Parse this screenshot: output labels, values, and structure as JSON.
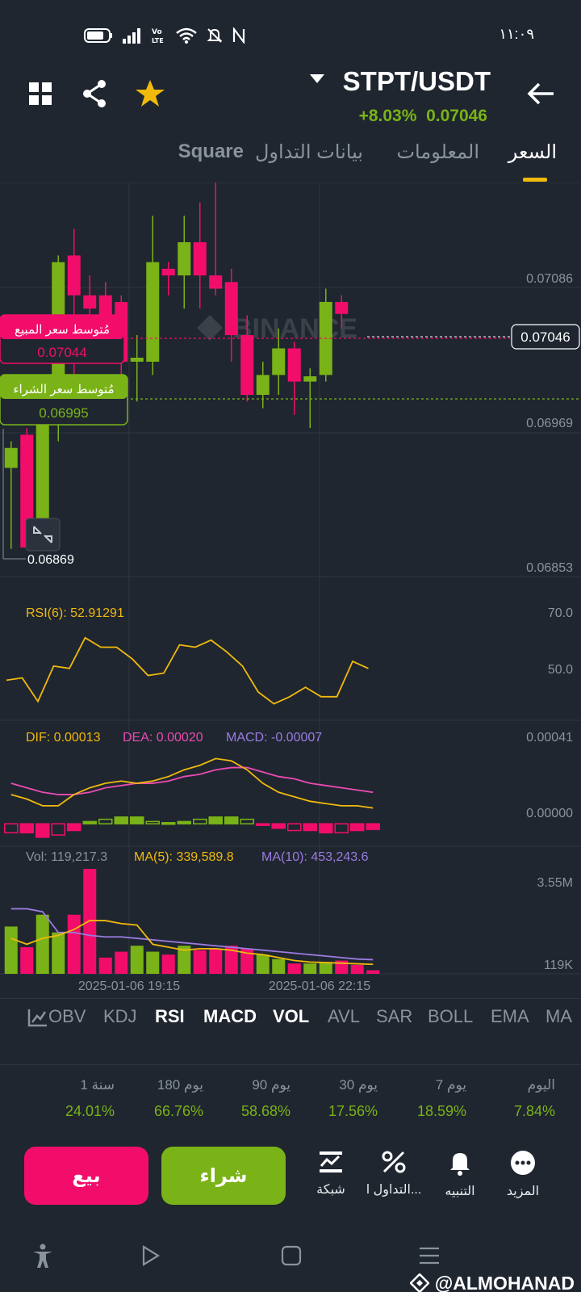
{
  "status_bar": {
    "time": "١١:٠٩"
  },
  "header": {
    "pair": "STPT/USDT",
    "change_percent": "+8.03%",
    "last_price": "0.07046"
  },
  "tabs": [
    {
      "label": "السعر",
      "active": true
    },
    {
      "label": "المعلومات",
      "active": false
    },
    {
      "label": "بيانات التداول",
      "active": false
    },
    {
      "label": "Square",
      "active": false
    }
  ],
  "chart": {
    "price_axis": [
      "0.07086",
      "0.06969",
      "0.06853"
    ],
    "current_price_tag": "0.07046",
    "low_marker": "0.06869",
    "avg_sell": {
      "label": "مُتوسط سعر المبيع",
      "value": "0.07044"
    },
    "avg_buy": {
      "label": "مُتوسط سعر الشراء",
      "value": "0.06995"
    },
    "rsi": {
      "legend": "RSI(6): 52.91291",
      "axis": [
        "70.0",
        "50.0"
      ]
    },
    "macd": {
      "dif": "DIF: 0.00013",
      "dea": "DEA: 0.00020",
      "macd": "MACD: -0.00007",
      "axis": [
        "0.00041",
        "0.00000"
      ]
    },
    "vol": {
      "vol": "Vol: 119,217.3",
      "ma5": "MA(5): 339,589.8",
      "ma10": "MA(10): 453,243.6",
      "axis": [
        "3.55M",
        "119K"
      ]
    },
    "time_labels": [
      "2025-01-06 19:15",
      "2025-01-06 22:15"
    ]
  },
  "chart_data": {
    "type": "candlestick",
    "colors": {
      "up": "#7ab317",
      "down": "#f20d6b",
      "rsi": "#f0b90b",
      "dea": "#e94bb1",
      "ma10": "#9b7be0"
    },
    "candles": [
      {
        "o": 0.0693,
        "h": 0.0695,
        "l": 0.06869,
        "c": 0.06945
      },
      {
        "o": 0.06955,
        "h": 0.0696,
        "l": 0.069,
        "c": 0.0687
      },
      {
        "o": 0.0687,
        "h": 0.07,
        "l": 0.06869,
        "c": 0.06995
      },
      {
        "o": 0.0699,
        "h": 0.0709,
        "l": 0.0695,
        "c": 0.07085
      },
      {
        "o": 0.0709,
        "h": 0.0711,
        "l": 0.06975,
        "c": 0.0706
      },
      {
        "o": 0.0706,
        "h": 0.07075,
        "l": 0.0702,
        "c": 0.0705
      },
      {
        "o": 0.0706,
        "h": 0.0707,
        "l": 0.0703,
        "c": 0.0704
      },
      {
        "o": 0.07055,
        "h": 0.0706,
        "l": 0.0699,
        "c": 0.0701
      },
      {
        "o": 0.0701,
        "h": 0.0703,
        "l": 0.0698,
        "c": 0.07013
      },
      {
        "o": 0.0701,
        "h": 0.0712,
        "l": 0.07,
        "c": 0.07085
      },
      {
        "o": 0.0708,
        "h": 0.07085,
        "l": 0.0706,
        "c": 0.07075
      },
      {
        "o": 0.07075,
        "h": 0.0712,
        "l": 0.0705,
        "c": 0.071
      },
      {
        "o": 0.071,
        "h": 0.0713,
        "l": 0.0705,
        "c": 0.07075
      },
      {
        "o": 0.07075,
        "h": 0.07145,
        "l": 0.0706,
        "c": 0.07065
      },
      {
        "o": 0.0707,
        "h": 0.0708,
        "l": 0.0701,
        "c": 0.0703
      },
      {
        "o": 0.0703,
        "h": 0.07045,
        "l": 0.0698,
        "c": 0.06985
      },
      {
        "o": 0.06985,
        "h": 0.0701,
        "l": 0.06975,
        "c": 0.07
      },
      {
        "o": 0.07,
        "h": 0.07035,
        "l": 0.06985,
        "c": 0.0702
      },
      {
        "o": 0.0702,
        "h": 0.07025,
        "l": 0.0697,
        "c": 0.06995
      },
      {
        "o": 0.06995,
        "h": 0.07005,
        "l": 0.0696,
        "c": 0.06999
      },
      {
        "o": 0.07,
        "h": 0.07065,
        "l": 0.06995,
        "c": 0.07055
      },
      {
        "o": 0.07055,
        "h": 0.0706,
        "l": 0.07035,
        "c": 0.07046
      }
    ],
    "rsi": [
      47,
      48,
      38,
      53,
      52,
      65,
      61,
      61,
      56,
      49,
      50,
      62,
      61,
      64,
      59,
      53,
      42,
      37,
      40,
      44,
      40,
      40,
      55,
      52
    ],
    "macd_hist": [
      -4e-05,
      -4e-05,
      -6e-05,
      -5e-05,
      -3e-05,
      1e-05,
      2e-05,
      3e-05,
      3e-05,
      1e-05,
      5e-06,
      1e-05,
      2e-05,
      3e-05,
      3e-05,
      2e-05,
      -5e-06,
      -2e-05,
      -3e-05,
      -3e-05,
      -4e-05,
      -4e-05,
      -3e-05,
      -2.5e-05
    ],
    "dif": [
      0.00013,
      0.00011,
      8e-05,
      8e-05,
      0.00013,
      0.00016,
      0.00018,
      0.00019,
      0.00018,
      0.00019,
      0.00021,
      0.00024,
      0.00026,
      0.00029,
      0.00028,
      0.00024,
      0.00018,
      0.00014,
      0.00012,
      0.0001,
      9e-05,
      8e-05,
      8e-05,
      7e-05
    ],
    "dea": [
      0.00018,
      0.00016,
      0.00014,
      0.00013,
      0.00013,
      0.00014,
      0.00016,
      0.00017,
      0.00018,
      0.00018,
      0.00019,
      0.00021,
      0.00022,
      0.00024,
      0.00025,
      0.00025,
      0.00023,
      0.00021,
      0.0002,
      0.00018,
      0.00017,
      0.00016,
      0.00015,
      0.00014
    ],
    "volume": [
      1.6,
      0.9,
      2.0,
      1.4,
      2.0,
      3.55,
      0.55,
      0.75,
      0.95,
      0.75,
      0.65,
      0.95,
      0.8,
      0.85,
      0.95,
      0.85,
      0.65,
      0.5,
      0.35,
      0.35,
      0.4,
      0.45,
      0.3,
      0.119
    ],
    "ma5": [
      1.2,
      1.0,
      1.2,
      1.3,
      1.5,
      1.8,
      1.8,
      1.7,
      1.65,
      1.0,
      0.9,
      0.8,
      0.85,
      0.85,
      0.8,
      0.7,
      0.65,
      0.55,
      0.45,
      0.4,
      0.38,
      0.36,
      0.34,
      0.32
    ],
    "ma10": [
      2.2,
      2.2,
      2.1,
      1.4,
      1.4,
      1.3,
      1.25,
      1.25,
      1.2,
      1.15,
      1.1,
      1.05,
      1.0,
      0.95,
      0.9,
      0.85,
      0.8,
      0.75,
      0.7,
      0.65,
      0.6,
      0.55,
      0.5,
      0.48
    ],
    "price_range": [
      0.06853,
      0.07145
    ],
    "rsi_range": [
      30,
      80
    ],
    "macd_range": [
      -0.0001,
      0.00041
    ],
    "vol_range": [
      0,
      3.55
    ]
  },
  "indicator_tabs": [
    {
      "label": "OBV",
      "active": false
    },
    {
      "label": "KDJ",
      "active": false
    },
    {
      "label": "RSI",
      "active": true
    },
    {
      "label": "MACD",
      "active": true
    },
    {
      "label": "VOL",
      "active": true
    },
    {
      "label": "AVL",
      "active": false
    },
    {
      "label": "SAR",
      "active": false
    },
    {
      "label": "BOLL",
      "active": false
    },
    {
      "label": "EMA",
      "active": false
    },
    {
      "label": "MA",
      "active": false
    }
  ],
  "periods": [
    {
      "label": "اليوم",
      "value": "7.84%"
    },
    {
      "label": "7 يوم",
      "value": "18.59%"
    },
    {
      "label": "30 يوم",
      "value": "17.56%"
    },
    {
      "label": "90 يوم",
      "value": "58.68%"
    },
    {
      "label": "180 يوم",
      "value": "66.76%"
    },
    {
      "label": "1 سنة",
      "value": "24.01%"
    }
  ],
  "actions": {
    "sell": "بيع",
    "buy": "شراء",
    "grid": "شبكة",
    "trading": "التداول ا...",
    "alert": "التنبيه",
    "more": "المزيد"
  },
  "watermark": "@ALMOHANAD"
}
